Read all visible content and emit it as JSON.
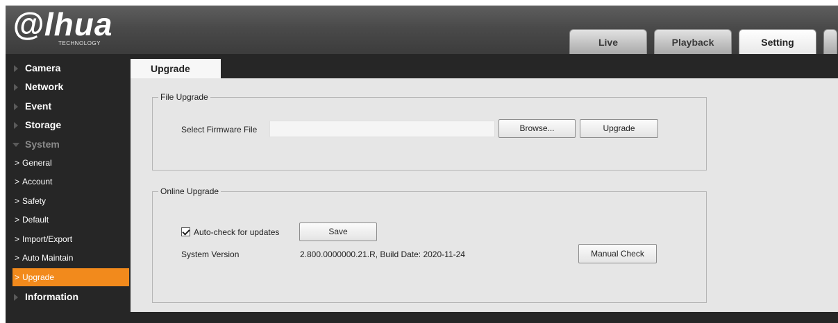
{
  "logo": {
    "word": "alhua",
    "tagline": "TECHNOLOGY"
  },
  "top_tabs": [
    {
      "label": "Live"
    },
    {
      "label": "Playback"
    },
    {
      "label": "Setting",
      "active": true
    },
    {
      "label": ""
    }
  ],
  "sidebar": {
    "top_items": [
      {
        "label": "Camera"
      },
      {
        "label": "Network"
      },
      {
        "label": "Event"
      },
      {
        "label": "Storage"
      },
      {
        "label": "System",
        "expanded": true
      },
      {
        "label": "Information"
      }
    ],
    "system_items": [
      {
        "label": "General"
      },
      {
        "label": "Account"
      },
      {
        "label": "Safety"
      },
      {
        "label": "Default"
      },
      {
        "label": "Import/Export"
      },
      {
        "label": "Auto Maintain"
      },
      {
        "label": "Upgrade",
        "active": true
      }
    ],
    "chevron": ">"
  },
  "page": {
    "tab_label": "Upgrade",
    "file_upgrade": {
      "legend": "File Upgrade",
      "select_label": "Select Firmware File",
      "file_value": "",
      "browse_label": "Browse...",
      "upgrade_label": "Upgrade"
    },
    "online_upgrade": {
      "legend": "Online Upgrade",
      "auto_check_label": "Auto-check for updates",
      "auto_check_checked": true,
      "save_label": "Save",
      "version_label": "System Version",
      "version_value": "2.800.0000000.21.R, Build Date: 2020-11-24",
      "manual_check_label": "Manual Check"
    }
  },
  "colors": {
    "accent": "#f28a1c",
    "background": "#262626",
    "panel": "#e6e6e6"
  }
}
